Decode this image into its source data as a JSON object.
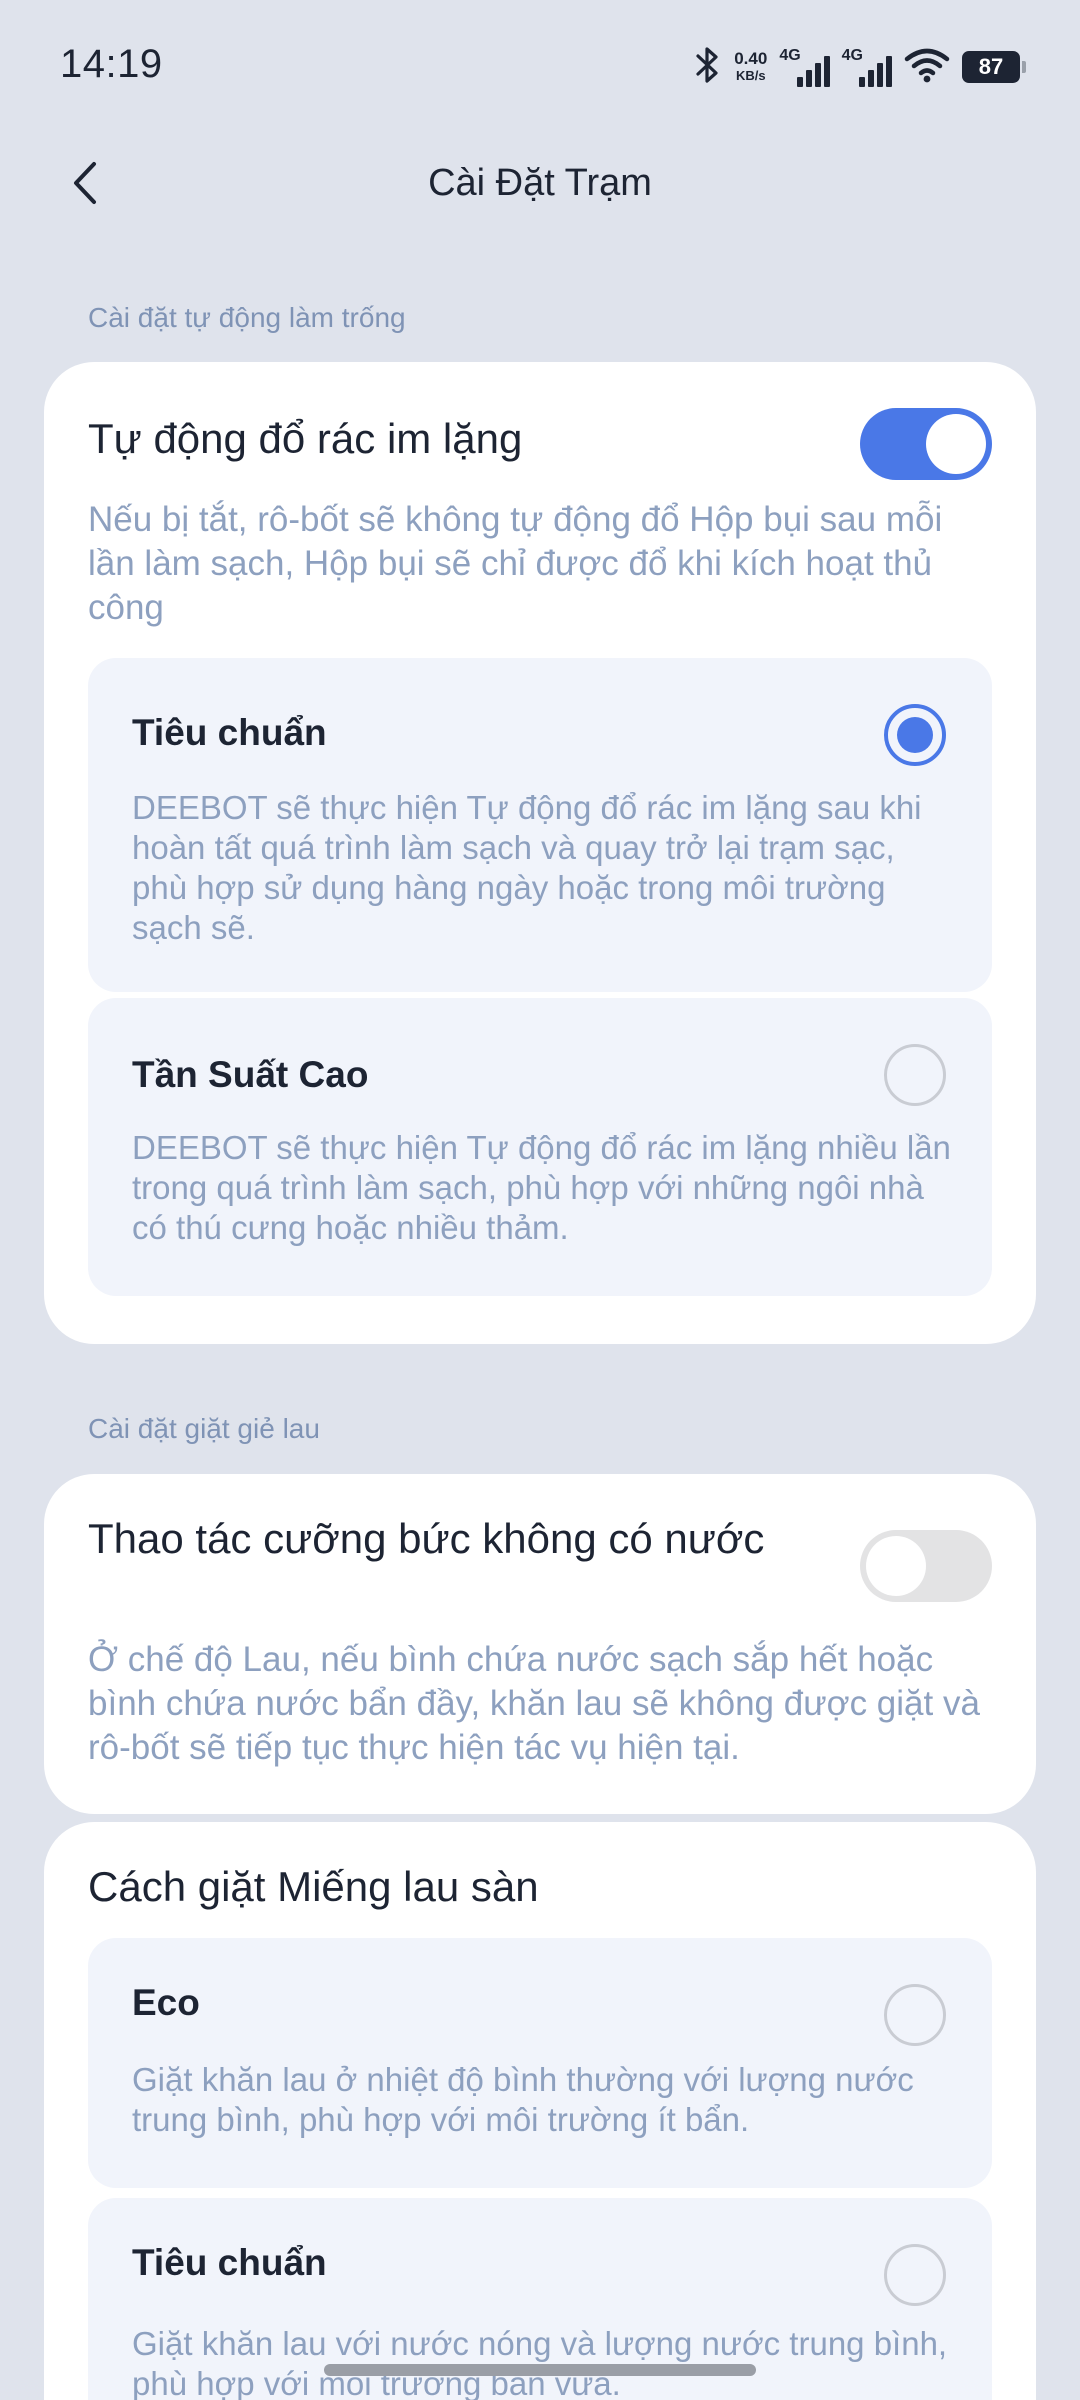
{
  "status_bar": {
    "time": "14:19",
    "net_speed_value": "0.40",
    "net_speed_unit": "KB/s",
    "network_1": "4G",
    "network_2": "4G",
    "battery": "87"
  },
  "header": {
    "title": "Cài Đặt Trạm",
    "back_icon": "chevron-left-icon"
  },
  "auto_empty": {
    "section_label": "Cài đặt tự động làm trống",
    "toggle_title": "Tự động đổ rác im lặng",
    "toggle_on": true,
    "toggle_desc": "Nếu bị tắt, rô-bốt sẽ không tự động đổ Hộp bụi sau mỗi lần làm sạch, Hộp bụi sẽ chỉ được đổ khi kích hoạt thủ công",
    "options": [
      {
        "title": "Tiêu chuẩn",
        "desc": "DEEBOT sẽ thực hiện Tự động đổ rác im lặng sau khi hoàn tất quá trình làm sạch và quay trở lại trạm sạc, phù hợp sử dụng hàng ngày hoặc trong môi trường sạch sẽ.",
        "selected": true
      },
      {
        "title": "Tần Suất Cao",
        "desc": "DEEBOT sẽ thực hiện Tự động đổ rác im lặng nhiều lần trong quá trình làm sạch, phù hợp với những ngôi nhà có thú cưng hoặc nhiều thảm.",
        "selected": false
      }
    ]
  },
  "mop_wash": {
    "section_label": "Cài đặt giặt giẻ lau",
    "toggle_title": "Thao tác cưỡng bức không có nước",
    "toggle_on": false,
    "toggle_desc": "Ở chế độ Lau, nếu bình chứa nước sạch sắp hết hoặc bình chứa nước bẩn đầy, khăn lau sẽ không được giặt và rô-bốt sẽ tiếp tục thực hiện tác vụ hiện tại.",
    "method_title": "Cách giặt Miếng lau sàn",
    "options": [
      {
        "title": "Eco",
        "desc": "Giặt khăn lau ở nhiệt độ bình thường với lượng nước trung bình, phù hợp với môi trường ít bẩn.",
        "selected": false
      },
      {
        "title": "Tiêu chuẩn",
        "desc": "Giặt khăn lau với nước nóng và lượng nước trung bình, phù hợp với môi trường bẩn vừa.",
        "selected": false
      }
    ]
  },
  "colors": {
    "accent": "#4a78e7",
    "background": "#dfe3ec",
    "card": "#ffffff",
    "option_bg": "#f1f4fb",
    "secondary_text": "#8da0bf"
  }
}
